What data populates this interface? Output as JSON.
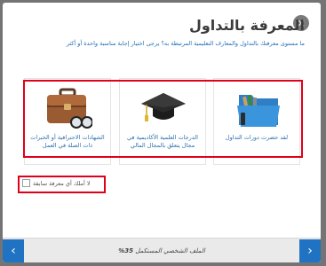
{
  "modal": {
    "close_icon": "×",
    "title": "المعرفة بالتداول",
    "subtitle": "ما مستوى معرفتك بالتداول والمعارف التعليمية المرتبطة به؟ يرجى اختيار إجابة مناسبة واحدة أو أكثر"
  },
  "cards": [
    {
      "icon": "briefcase-glasses-icon",
      "label": "الشهادات الاحترافية أو الخبرات ذات الصلة في العمل"
    },
    {
      "icon": "graduation-cap-icon",
      "label": "الدرجات العلمية الأكاديمية في مجال يتعلق بالمجال المالي"
    },
    {
      "icon": "folder-documents-icon",
      "label": "لقد حضرت دورات التداول"
    }
  ],
  "no_knowledge": {
    "label": "لا أملك أي معرفة سابقة",
    "checked": false
  },
  "footer": {
    "prev_icon": "‹",
    "next_icon": "›",
    "progress_label": "الملف الشخصي المستكمل",
    "progress_value": "35%"
  },
  "colors": {
    "accent": "#1f73c2",
    "highlight": "#e0001a",
    "overlay": "#747474"
  }
}
